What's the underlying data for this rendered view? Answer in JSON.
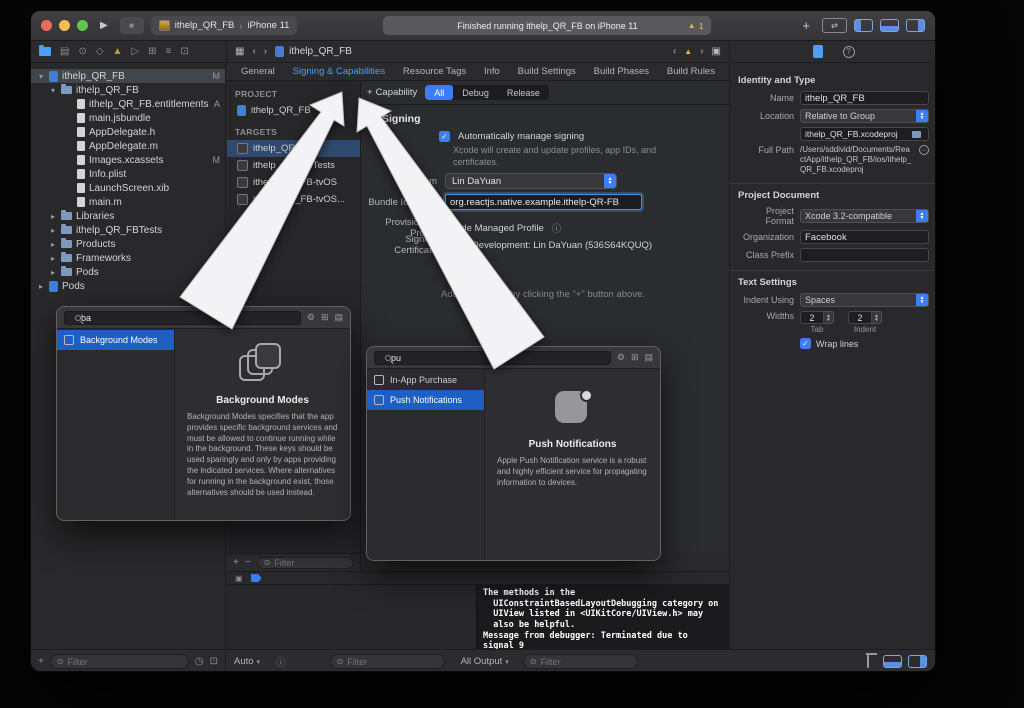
{
  "colors": {
    "accent_blue": "#3d7df7",
    "selection_blue": "#1f5fc4",
    "warning_yellow": "#e8b63a",
    "callout_arrow": "#f3f3f5"
  },
  "icons": {
    "play": "▶",
    "stop": "■",
    "chev_left": "‹",
    "chev_right": "›",
    "warning": "▲",
    "plus": "+",
    "minus": "−",
    "gear": "⚙",
    "grid": "⊞",
    "list": "▤",
    "grid2": "▦",
    "sq": "▣",
    "info": "ⓘ",
    "clock": "◷",
    "check": "✓",
    "disc_open": "▾",
    "disc_closed": "▸",
    "dropdown": "▾",
    "box": "⊡",
    "target": "⊙",
    "qmark": "?",
    "swap": "⇄",
    "diamond": "◇",
    "tri_right": "▷",
    "equal": "≡"
  },
  "titlebar": {
    "scheme_app": "ithelp_QR_FB",
    "scheme_device": "iPhone 11",
    "status": "Finished running ithelp_QR_FB on iPhone 11",
    "warning_count": "1"
  },
  "jumpbar": {
    "title": "ithelp_QR_FB"
  },
  "navigator": {
    "filter_placeholder": "Filter",
    "files": [
      {
        "name": "ithelp_QR_FB",
        "badge": "M"
      },
      {
        "name": "ithelp_QR_FB",
        "badge": ""
      },
      {
        "name": "ithelp_QR_FB.entitlements",
        "badge": "A"
      },
      {
        "name": "main.jsbundle",
        "badge": ""
      },
      {
        "name": "AppDelegate.h",
        "badge": ""
      },
      {
        "name": "AppDelegate.m",
        "badge": ""
      },
      {
        "name": "Images.xcassets",
        "badge": "M"
      },
      {
        "name": "Info.plist",
        "badge": ""
      },
      {
        "name": "LaunchScreen.xib",
        "badge": ""
      },
      {
        "name": "main.m",
        "badge": ""
      },
      {
        "name": "Libraries",
        "badge": ""
      },
      {
        "name": "ithelp_QR_FBTests",
        "badge": ""
      },
      {
        "name": "Products",
        "badge": ""
      },
      {
        "name": "Frameworks",
        "badge": ""
      },
      {
        "name": "Pods",
        "badge": ""
      },
      {
        "name": "Pods",
        "badge": ""
      }
    ]
  },
  "editor": {
    "tabs": [
      "General",
      "Signing & Capabilities",
      "Resource Tags",
      "Info",
      "Build Settings",
      "Build Phases",
      "Build Rules"
    ],
    "project_header": "PROJECT",
    "project_name": "ithelp_QR_FB",
    "targets_header": "TARGETS",
    "targets": [
      "ithelp_QR_FB",
      "ithelp_QR_FBTests",
      "ithelp_QR_FB-tvOS",
      "ithelp_QR_FB-tvOS..."
    ],
    "capability_button": "Capability",
    "segments": [
      "All",
      "Debug",
      "Release"
    ],
    "section_title": "Signing",
    "auto_signing_label": "Automatically manage signing",
    "auto_signing_sub": "Xcode will create and update profiles, app IDs, and certificates.",
    "team_label": "Team",
    "team_value": "Lin  DaYuan",
    "bundle_label": "Bundle Identifier",
    "bundle_value": "org.reactjs.native.example.ithelp-QR-FB",
    "profile_label": "Provisioning Profile",
    "profile_value": "Xcode Managed Profile",
    "cert_label": "Signing Certificate",
    "cert_value": "Apple Development: Lin  DaYuan (536S64KQUQ)",
    "add_hint": "Add capabilities by clicking the \"+\" button above.",
    "filter_placeholder": "Filter"
  },
  "popover_ba": {
    "search_value": "ba",
    "items": [
      "Background Modes"
    ],
    "title": "Background Modes",
    "description": "Background Modes specifies that the app provides specific background services and must be allowed to continue running while in the background. These keys should be used sparingly and only by apps providing the indicated services. Where alternatives for running in the background exist, those alternatives should be used instead."
  },
  "popover_pu": {
    "search_value": "pu",
    "items": [
      "In-App Purchase",
      "Push Notifications"
    ],
    "title": "Push Notifications",
    "description": "Apple Push Notification service is a robust and highly efficient service for propagating information to devices."
  },
  "inspector": {
    "identity_header": "Identity and Type",
    "name_label": "Name",
    "name_value": "ithelp_QR_FB",
    "location_label": "Location",
    "location_value": "Relative to Group",
    "file_value": "ithelp_QR_FB.xcodeproj",
    "fullpath_label": "Full Path",
    "fullpath_value": "/Users/sddivid/Documents/ReactApp/ithelp_QR_FB/ios/ithelp_QR_FB.xcodeproj",
    "document_header": "Project Document",
    "format_label": "Project Format",
    "format_value": "Xcode 3.2-compatible",
    "org_label": "Organization",
    "org_value": "Facebook",
    "class_prefix_label": "Class Prefix",
    "class_prefix_value": "",
    "text_header": "Text Settings",
    "indent_label": "Indent Using",
    "indent_value": "Spaces",
    "widths_label": "Widths",
    "tab_width": "2",
    "indent_width": "2",
    "tab_caption": "Tab",
    "indent_caption": "Indent",
    "wrap_label": "Wrap lines"
  },
  "debug": {
    "auto_label": "Auto",
    "filter_placeholder": "Filter",
    "all_output_label": "All Output",
    "console_text": "The methods in the\n  UIConstraintBasedLayoutDebugging category on\n  UIView listed in <UIKitCore/UIView.h> may\n  also be helpful.\nMessage from debugger: Terminated due to signal 9"
  }
}
